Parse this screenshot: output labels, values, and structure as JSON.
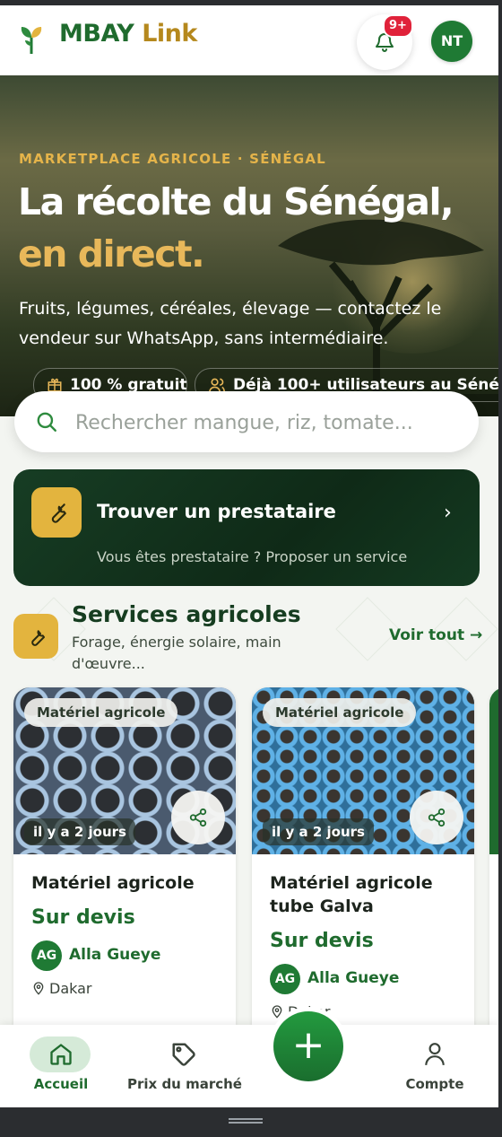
{
  "app": {
    "brand_part1": "MBAY",
    "brand_part2": "Link",
    "notification_badge": "9+",
    "user_initials": "NT"
  },
  "hero": {
    "kicker": "MARKETPLACE AGRICOLE · SÉNÉGAL",
    "title_line1": "La récolte du Sénégal,",
    "title_line2": "en direct.",
    "subtitle": "Fruits, légumes, céréales, élevage — contactez le vendeur sur WhatsApp, sans intermédiaire.",
    "pills": [
      "100 % gratuit",
      "Déjà 100+ utilisateurs au Sénég"
    ]
  },
  "search": {
    "placeholder": "Rechercher mangue, riz, tomate..."
  },
  "provider_banner": {
    "title": "Trouver un prestataire",
    "subtitle": "Vous êtes prestataire ? Proposer un service"
  },
  "services": {
    "title": "Services agricoles",
    "subtitle": "Forage, énergie solaire, main d'œuvre...",
    "see_all": "Voir tout →"
  },
  "listings": [
    {
      "category": "Matériel agricole",
      "age": "il y a 2 jours",
      "title": "Matériel agricole",
      "price": "Sur devis",
      "seller_initials": "AG",
      "seller_name": "Alla Gueye",
      "location": "Dakar"
    },
    {
      "category": "Matériel agricole",
      "age": "il y a 2 jours",
      "title": "Matériel agricole tube Galva",
      "price": "Sur devis",
      "seller_initials": "AG",
      "seller_name": "Alla Gueye",
      "location": "Dakar"
    }
  ],
  "bottom_nav": {
    "home": "Accueil",
    "market_prices": "Prix du marché",
    "add": "+",
    "account": "Compte"
  },
  "colors": {
    "primary_green": "#1f6b2e",
    "accent_gold": "#e3b43e",
    "badge_red": "#e0223a"
  }
}
